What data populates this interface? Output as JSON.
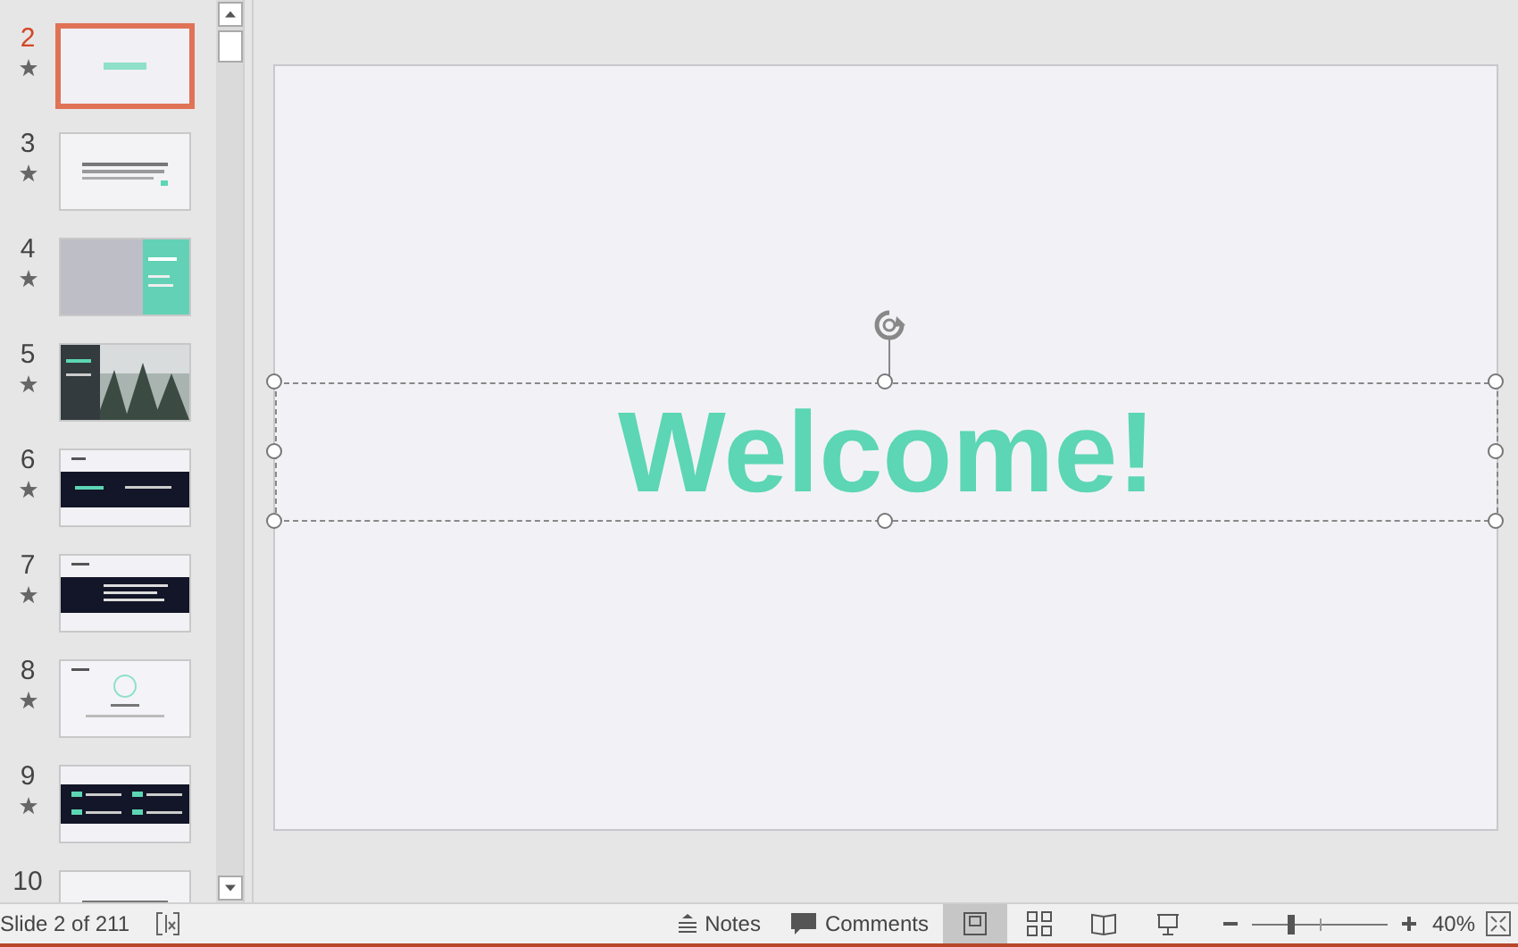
{
  "slides": [
    {
      "number": "2",
      "selected": true,
      "animated": true,
      "kind": "title"
    },
    {
      "number": "3",
      "selected": false,
      "animated": true,
      "kind": "text"
    },
    {
      "number": "4",
      "selected": false,
      "animated": true,
      "kind": "split"
    },
    {
      "number": "5",
      "selected": false,
      "animated": true,
      "kind": "forest"
    },
    {
      "number": "6",
      "selected": false,
      "animated": true,
      "kind": "band"
    },
    {
      "number": "7",
      "selected": false,
      "animated": true,
      "kind": "band-text"
    },
    {
      "number": "8",
      "selected": false,
      "animated": true,
      "kind": "circle"
    },
    {
      "number": "9",
      "selected": false,
      "animated": true,
      "kind": "grid"
    },
    {
      "number": "10",
      "selected": false,
      "kind": "text"
    }
  ],
  "slide": {
    "title": "Welcome!",
    "selected": true
  },
  "status_bar": {
    "slide_info": "Slide 2 of 211",
    "notes": "Notes",
    "comments": "Comments",
    "views": [
      {
        "kind": "normal",
        "selected": true
      },
      {
        "kind": "sorter",
        "selected": false
      },
      {
        "kind": "reading",
        "selected": false
      },
      {
        "kind": "slideshow",
        "selected": false
      }
    ],
    "zoom": {
      "level": 0.29,
      "reading": "40%"
    }
  }
}
